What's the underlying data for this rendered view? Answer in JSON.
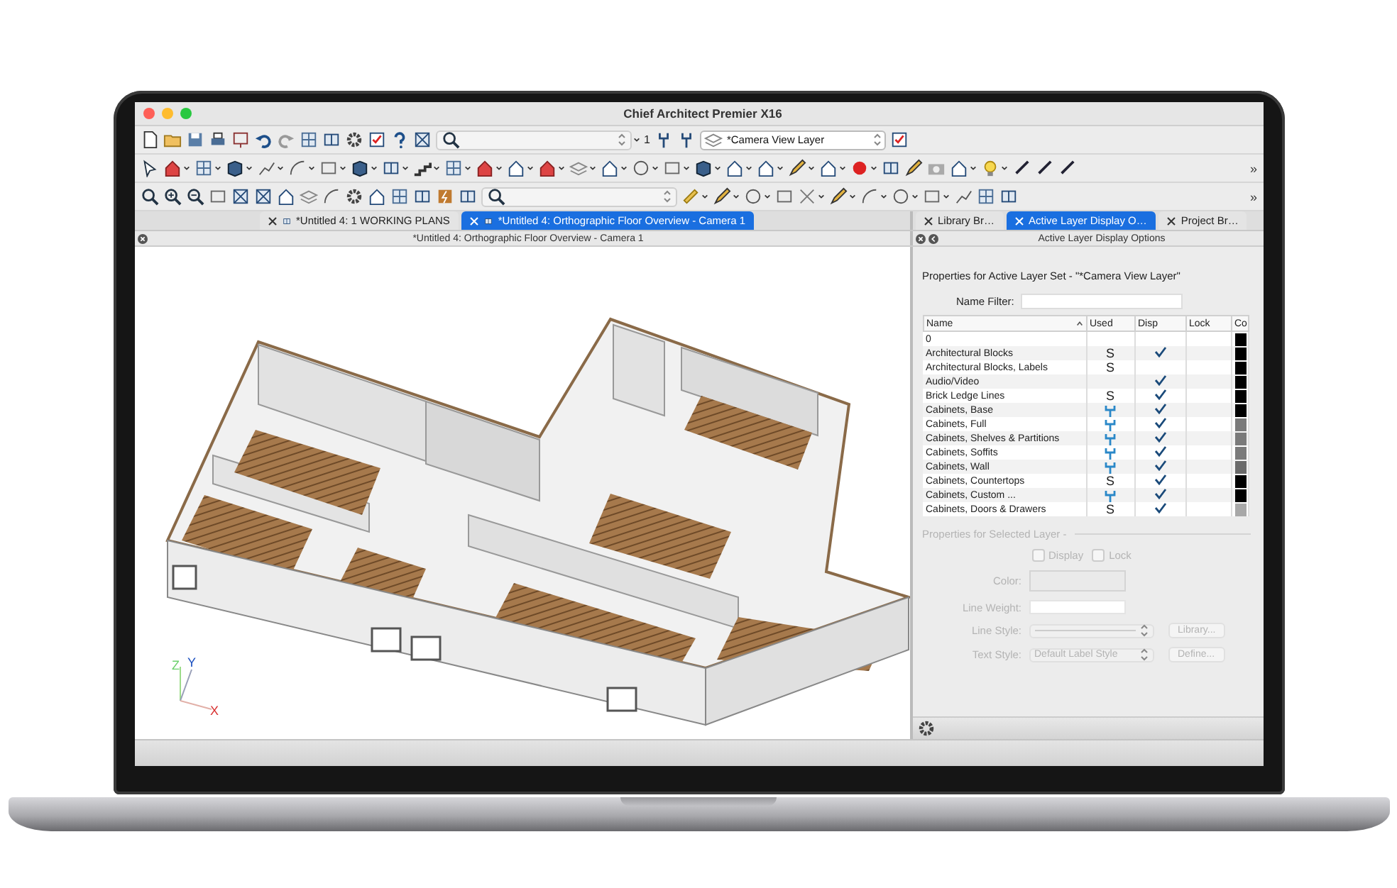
{
  "window": {
    "title": "Chief Architect Premier X16"
  },
  "toolbar": {
    "floor_number": "1",
    "layer_select": "*Camera View Layer",
    "overflow": [
      "»",
      "»"
    ]
  },
  "document_tabs": [
    {
      "label": "*Untitled 4: 1 WORKING PLANS",
      "selected": false
    },
    {
      "label": "*Untitled 4: Orthographic Floor Overview - Camera 1",
      "selected": true
    }
  ],
  "view": {
    "title": "*Untitled 4: Orthographic Floor Overview - Camera 1",
    "axes": {
      "z": "Z",
      "y": "Y",
      "x": "X"
    }
  },
  "panel": {
    "tabs": [
      {
        "label": "Library Br…",
        "selected": false
      },
      {
        "label": "Active Layer Display O…",
        "selected": true
      },
      {
        "label": "Project Br…",
        "selected": false
      }
    ],
    "title": "Active Layer Display Options",
    "heading": "Properties for Active Layer Set - \"*Camera View Layer\"",
    "name_filter_label": "Name Filter:",
    "table": {
      "columns": [
        "Name",
        "Used",
        "Disp",
        "Lock",
        "Co"
      ],
      "rows": [
        {
          "name": "0",
          "used_icon": false,
          "disp": false,
          "color": "#000000"
        },
        {
          "name": "Architectural Blocks",
          "used": "S",
          "used_icon": false,
          "disp": true,
          "color": "#000000"
        },
        {
          "name": "Architectural Blocks, Labels",
          "used": "S",
          "used_icon": false,
          "disp": false,
          "color": "#000000"
        },
        {
          "name": "Audio/Video",
          "used_icon": false,
          "disp": true,
          "color": "#000000"
        },
        {
          "name": "Brick Ledge Lines",
          "used": "S",
          "used_icon": false,
          "disp": true,
          "color": "#000000"
        },
        {
          "name": "Cabinets,  Base",
          "used_icon": true,
          "disp": true,
          "color": "#000000"
        },
        {
          "name": "Cabinets,  Full",
          "used_icon": true,
          "disp": true,
          "color": "#7a7a7a"
        },
        {
          "name": "Cabinets,  Shelves & Partitions",
          "used_icon": true,
          "disp": true,
          "color": "#7a7a7a"
        },
        {
          "name": "Cabinets,  Soffits",
          "used_icon": true,
          "disp": true,
          "color": "#7a7a7a"
        },
        {
          "name": "Cabinets,  Wall",
          "used_icon": true,
          "disp": true,
          "color": "#6a6a6a"
        },
        {
          "name": "Cabinets, Countertops",
          "used": "S",
          "used_icon": false,
          "disp": true,
          "color": "#000000"
        },
        {
          "name": "Cabinets, Custom ...",
          "used_icon": true,
          "disp": true,
          "color": "#000000"
        },
        {
          "name": "Cabinets, Doors & Drawers",
          "used": "S",
          "used_icon": false,
          "disp": true,
          "color": "#a8a8a8"
        }
      ]
    },
    "selected_layer": {
      "heading": "Properties for Selected Layer -",
      "disabled": true,
      "display": {
        "label": "Display",
        "checked": false
      },
      "lock": {
        "label": "Lock",
        "checked": false
      },
      "color_label": "Color:",
      "line_weight_label": "Line Weight:",
      "line_style_label": "Line Style:",
      "library_button": "Library...",
      "text_style_label": "Text Style:",
      "text_style_value": "Default Label Style",
      "define_button": "Define..."
    }
  }
}
